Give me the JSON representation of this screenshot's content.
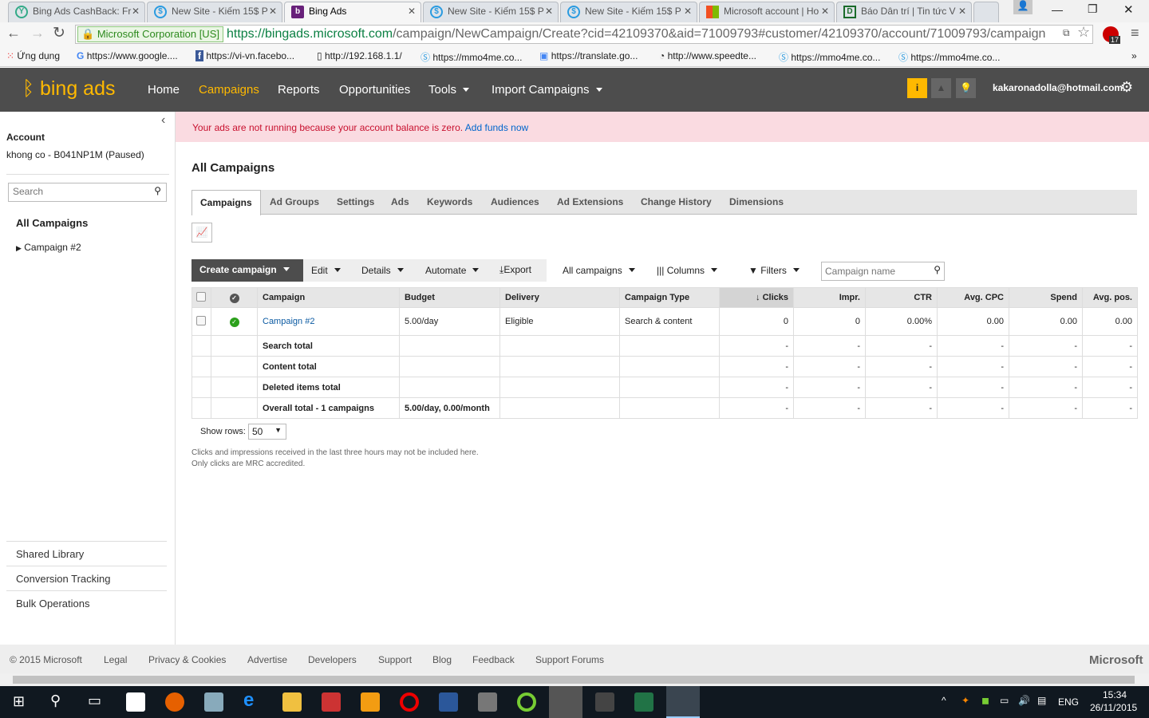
{
  "browser": {
    "tabs": [
      {
        "title": "Bing Ads CashBack: Fr"
      },
      {
        "title": "New Site - Kiếm 15$ P"
      },
      {
        "title": "Bing Ads"
      },
      {
        "title": "New Site - Kiếm 15$ P"
      },
      {
        "title": "New Site - Kiếm 15$ P"
      },
      {
        "title": "Microsoft account | Ho"
      },
      {
        "title": "Báo Dân trí | Tin tức V"
      }
    ],
    "ev_label": "Microsoft Corporation [US]",
    "url_host": "https://bingads.microsoft.com",
    "url_path": "/campaign/NewCampaign/Create?cid=42109370&aid=71009793#customer/42109370/account/71009793/campaign",
    "extension_badge": "17",
    "bookmarks": [
      "Ứng dụng",
      "https://www.google....",
      "https://vi-vn.facebo...",
      "http://192.168.1.1/",
      "https://mmo4me.co...",
      "https://translate.go...",
      "http://www.speedte...",
      "https://mmo4me.co...",
      "https://mmo4me.co..."
    ]
  },
  "header": {
    "logo": "bing ads",
    "nav": [
      "Home",
      "Campaigns",
      "Reports",
      "Opportunities",
      "Tools",
      "Import Campaigns"
    ],
    "user": "kakaronadolla@hotmail.com"
  },
  "sidebar": {
    "account_label": "Account",
    "account_name": "khong co - B041NP1M (Paused)",
    "search_placeholder": "Search",
    "all_campaigns": "All Campaigns",
    "campaign": "Campaign #2",
    "links": [
      "Shared Library",
      "Conversion Tracking",
      "Bulk Operations"
    ]
  },
  "banner": {
    "text": "Your ads are not running because your account balance is zero.",
    "link": "Add funds now"
  },
  "page_title": "All Campaigns",
  "tabs": [
    "Campaigns",
    "Ad Groups",
    "Settings",
    "Ads",
    "Keywords",
    "Audiences",
    "Ad Extensions",
    "Change History",
    "Dimensions"
  ],
  "toolbar": {
    "create": "Create campaign",
    "edit": "Edit",
    "details": "Details",
    "automate": "Automate",
    "export": "Export",
    "filter_view": "All campaigns",
    "columns": "Columns",
    "filters": "Filters",
    "search_placeholder": "Campaign name"
  },
  "table": {
    "columns": [
      "Campaign",
      "Budget",
      "Delivery",
      "Campaign Type",
      "Clicks",
      "Impr.",
      "CTR",
      "Avg. CPC",
      "Spend",
      "Avg. pos."
    ],
    "rows": [
      {
        "name": "Campaign #2",
        "budget": "5.00/day",
        "delivery": "Eligible",
        "type": "Search & content",
        "clicks": "0",
        "impr": "0",
        "ctr": "0.00%",
        "cpc": "0.00",
        "spend": "0.00",
        "pos": "0.00"
      }
    ],
    "totals": [
      {
        "label": "Search total",
        "budget": ""
      },
      {
        "label": "Content total",
        "budget": ""
      },
      {
        "label": "Deleted items total",
        "budget": ""
      },
      {
        "label": "Overall total - 1 campaigns",
        "budget": "5.00/day, 0.00/month"
      }
    ],
    "dash": "-"
  },
  "show_rows": {
    "label": "Show rows:",
    "value": "50"
  },
  "notes": [
    "Clicks and impressions received in the last three hours may not be included here.",
    "Only clicks are MRC accredited."
  ],
  "footer": {
    "links": [
      "© 2015 Microsoft",
      "Legal",
      "Privacy & Cookies",
      "Advertise",
      "Developers",
      "Support",
      "Blog",
      "Feedback",
      "Support Forums"
    ],
    "brand": "Microsoft"
  },
  "taskbar": {
    "lang": "ENG",
    "time": "15:34",
    "date": "26/11/2015"
  }
}
